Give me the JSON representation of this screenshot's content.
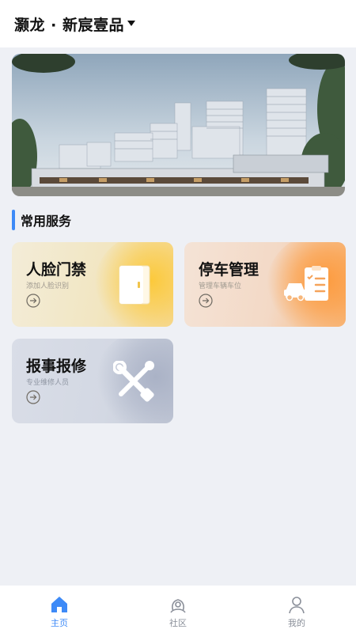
{
  "header": {
    "community_name": "灏龙 · 新宸壹品",
    "dropdown_icon": "caret-down-icon"
  },
  "banner": {
    "image": "residential-building-rendering"
  },
  "services": {
    "section_title": "常用服务",
    "accent_color": "#3d8af7",
    "items": [
      {
        "title": "人脸门禁",
        "subtitle": "添加人脸识别",
        "icon": "door-icon",
        "arrow_icon": "arrow-right-circle-icon",
        "accent": "#fcc93a"
      },
      {
        "title": "停车管理",
        "subtitle": "管理车辆车位",
        "icon": "car-clipboard-icon",
        "arrow_icon": "arrow-right-circle-icon",
        "accent": "#fd9a3c"
      },
      {
        "title": "报事报修",
        "subtitle": "专业维修人员",
        "icon": "wrench-screwdriver-icon",
        "arrow_icon": "arrow-right-circle-icon",
        "accent": "#aab2c6"
      }
    ]
  },
  "tabbar": {
    "active_color": "#3d8af7",
    "inactive_color": "#8a8f99",
    "items": [
      {
        "label": "主页",
        "icon": "home-icon",
        "active": true
      },
      {
        "label": "社区",
        "icon": "community-icon",
        "active": false
      },
      {
        "label": "我的",
        "icon": "user-icon",
        "active": false
      }
    ]
  }
}
